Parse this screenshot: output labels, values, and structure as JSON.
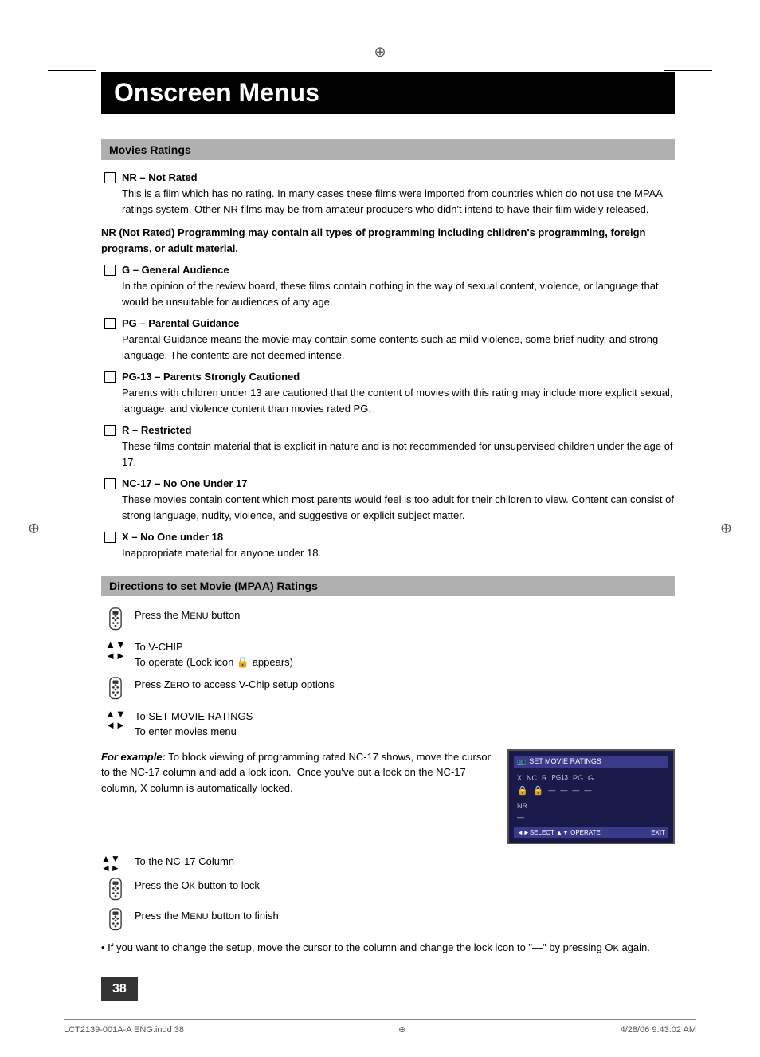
{
  "page": {
    "title": "Onscreen Menus",
    "page_number": "38",
    "footer_left": "LCT2139-001A-A ENG.indd   38",
    "footer_right": "4/28/06   9:43:02 AM"
  },
  "movies_ratings": {
    "section_title": "Movies Ratings",
    "ratings": [
      {
        "id": "NR",
        "title": "NR – Not Rated",
        "description": "This is a film which has no rating. In many cases these films were imported from countries which do not use the MPAA ratings system. Other NR films may be from amateur producers who didn't intend to have their film widely released."
      },
      {
        "id": "NR-note",
        "title": "",
        "description": "NR (Not Rated) Programming may contain all types of programming including children's programming, foreign programs, or adult material."
      },
      {
        "id": "G",
        "title": "G – General Audience",
        "description": "In the opinion of the review board, these films contain nothing in the way of sexual content, violence, or language that would be unsuitable for audiences of any age."
      },
      {
        "id": "PG",
        "title": "PG – Parental Guidance",
        "description": "Parental Guidance means the movie may contain some contents such as mild violence, some brief nudity, and strong language. The contents are not deemed intense."
      },
      {
        "id": "PG13",
        "title": "PG-13 – Parents Strongly Cautioned",
        "description": "Parents with children under 13 are cautioned that the content of movies with this rating may include more explicit sexual, language, and violence content than movies rated PG."
      },
      {
        "id": "R",
        "title": "R – Restricted",
        "description": "These films contain material that is explicit in nature and is not recommended for unsupervised children under the age of 17."
      },
      {
        "id": "NC17",
        "title": "NC-17 – No One Under 17",
        "description": "These movies contain content which most parents would feel is too adult for their children to view. Content can consist of strong language, nudity, violence, and suggestive or explicit subject matter."
      },
      {
        "id": "X",
        "title": "X – No One under 18",
        "description": "Inappropriate material for anyone under 18."
      }
    ]
  },
  "directions": {
    "section_title": "Directions to set Movie (MPAA) Ratings",
    "steps": [
      {
        "icon": "remote",
        "text": "Press the MENU button"
      },
      {
        "icon": "arrows-ud-lr",
        "text_line1": "To V-CHIP",
        "text_line2": "To operate (Lock icon 🔒 appears)"
      },
      {
        "icon": "remote",
        "text": "Press ZERO to access V-Chip setup options"
      },
      {
        "icon": "arrows-ud-lr",
        "text_line1": "To SET MOVIE RATINGS",
        "text_line2": "To enter movies menu"
      }
    ],
    "example_label": "For example:",
    "example_text": "To block viewing of programming rated NC-17 shows, move the cursor to the NC-17 column and add a lock icon.  Once you've put a lock on the NC-17 column, X column is automatically locked.",
    "substeps": [
      {
        "icon": "arrows-all",
        "text": "To the NC-17 Column"
      },
      {
        "icon": "remote",
        "text": "Press the OK button to lock"
      },
      {
        "icon": "remote",
        "text": "Press the MENU button to finish"
      }
    ],
    "bullet_note": "• If you want to change the setup, move the cursor to the column and change the lock icon to \"—\" by pressing OK again.",
    "tv_screen": {
      "title": "SET MOVIE RATINGS",
      "ratings_row": "X  NC  R  PG13  PG  G",
      "lock_row": "🔒  🔒  —  —  —  —",
      "nr_label": "NR",
      "nr_value": "—",
      "bottom_left": "◄►SELECT  ▲▼ OPERATE",
      "bottom_right": "EXIT"
    }
  }
}
